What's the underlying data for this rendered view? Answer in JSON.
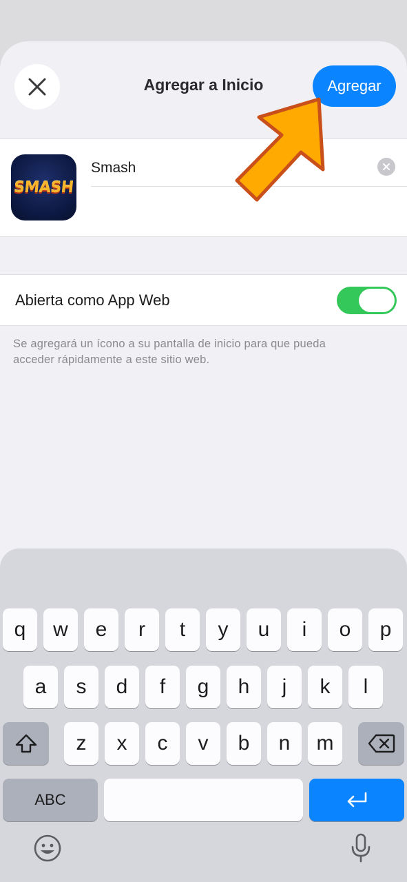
{
  "sheet": {
    "title": "Agregar a Inicio",
    "add_label": "Agregar",
    "app_name_value": "Smash",
    "app_icon_text": "SMASH",
    "webapp_label": "Abierta como App Web",
    "webapp_enabled": true,
    "footnote": "Se agregará un ícono a su pantalla de inicio para que pueda acceder rápidamente a este sitio web."
  },
  "keyboard": {
    "row1": [
      "q",
      "w",
      "e",
      "r",
      "t",
      "y",
      "u",
      "i",
      "o",
      "p"
    ],
    "row2": [
      "a",
      "s",
      "d",
      "f",
      "g",
      "h",
      "j",
      "k",
      "l"
    ],
    "row3": [
      "z",
      "x",
      "c",
      "v",
      "b",
      "n",
      "m"
    ],
    "abc_label": "ABC"
  },
  "colors": {
    "accent": "#0a84ff",
    "toggle_on": "#34c759",
    "arrow": "#ffaa00"
  }
}
